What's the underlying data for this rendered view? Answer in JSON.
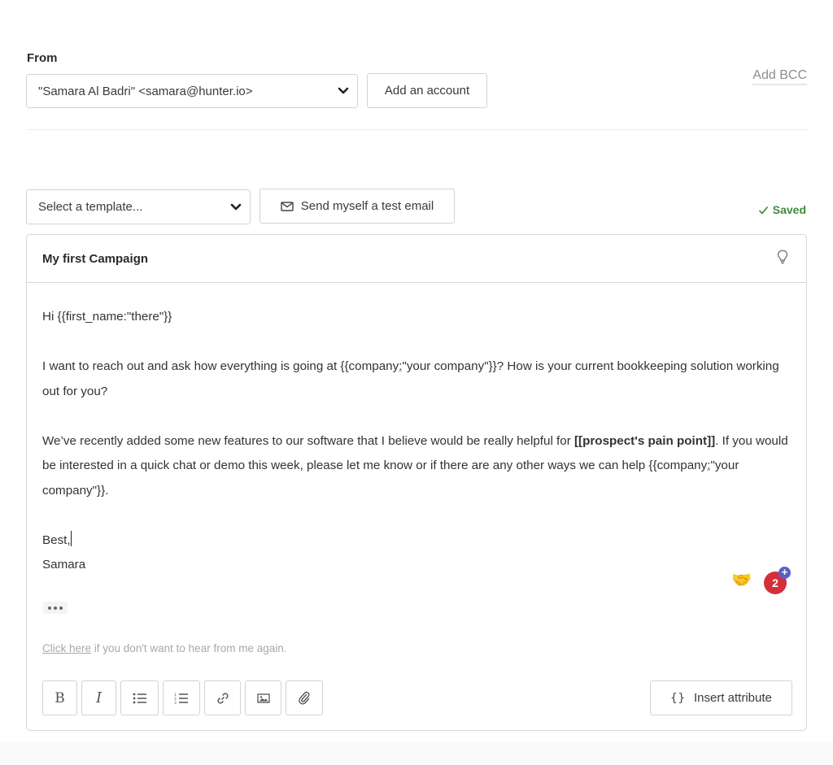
{
  "from": {
    "label": "From",
    "selected_account": "\"Samara Al Badri\" <samara@hunter.io>",
    "add_account_label": "Add an account",
    "add_bcc_label": "Add BCC"
  },
  "template_bar": {
    "template_select_placeholder": "Select a template...",
    "test_email_label": "Send myself a test email",
    "saved_status": "Saved"
  },
  "editor": {
    "subject": "My first Campaign",
    "body": {
      "greeting": "Hi {{first_name:\"there\"}}",
      "p1_before": "I want to reach out and ask how everything is going at {{company",
      "p1_colon": ":",
      "p1_after": "\"your company\"}}? How is your current bookkeeping solution working out for you?",
      "p2_before": "We’ve recently added some new features to our software that I believe would be really helpful for ",
      "p2_bold": "[[prospect's pain point]]",
      "p2_middle": ". If you would be interested in a quick chat or demo this week, please let me know or if there are any other ways we can help {{company",
      "p2_colon": ":",
      "p2_after": "\"your company\"}}.",
      "signoff": "Best,",
      "signature": "Samara"
    },
    "unsubscribe": {
      "link_text": "Click here",
      "rest_text": " if you don't want to hear from me again."
    },
    "reactions": {
      "emoji": "🤝",
      "count": "2",
      "plus": "+"
    },
    "toolbar": {
      "bold": "B",
      "italic": "I",
      "insert_attribute_label": "Insert attribute",
      "insert_attribute_icon": "{}"
    }
  }
}
